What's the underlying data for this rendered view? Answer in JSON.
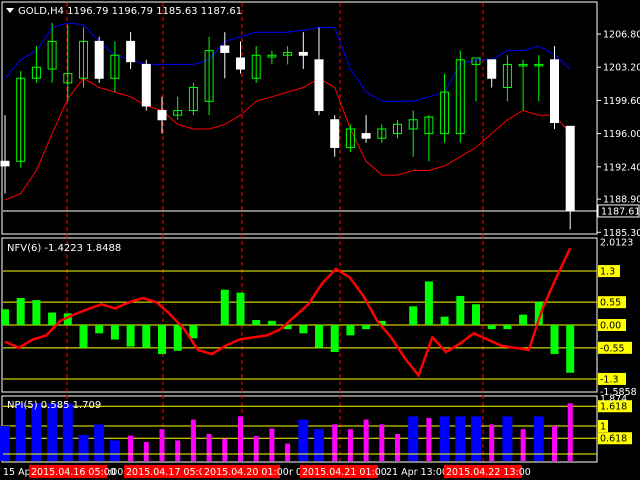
{
  "main_panel": {
    "title": "GOLD,H4  1196.79 1196.79 1185.63 1187.61",
    "price_ticks": [
      "1206.80",
      "1203.20",
      "1199.60",
      "1196.00",
      "1192.40",
      "1188.90",
      "1185.30"
    ],
    "current_price": "1187.61"
  },
  "nfv_panel": {
    "title": "NFV(6) -1.4223 1.8488",
    "top_label": "2.0123",
    "bottom_label": "-1.5858",
    "levels": [
      "1.3",
      "0.55",
      "0.00",
      "-0.55",
      "-1.3"
    ]
  },
  "npi_panel": {
    "title": "NPI(5) 0.585 1.709",
    "top_label": "1.874",
    "levels": [
      "1.618",
      "1",
      "0.618"
    ]
  },
  "time_axis": {
    "plain_labels": [
      "15 Ap",
      ":00",
      "r 05",
      "21 Apr 13:00"
    ],
    "highlighted_dates": [
      "2015.04.16 05:00",
      "2015.04.17 05:00",
      "2015.04.20 01:00",
      "2015.04.21 01:00",
      "2015.04.22 13:00"
    ]
  },
  "colors": {
    "background": "#000000",
    "bull_candle": "#00ff00",
    "bear_candle": "#ffffff",
    "upper_band": "#0000ff",
    "lower_band": "#ff0000",
    "level_line": "#ffff00",
    "marker_line": "#ff0000",
    "nfv_pos_hist": "#00ff00",
    "nfv_line": "#ff0000",
    "npi_blue": "#0000ff",
    "npi_magenta": "#ff00ff",
    "highlight_bg": "#ff0000",
    "level_label_bg": "#ffff00"
  },
  "chart_data": {
    "type": "candlestick",
    "candles": [
      {
        "o": 1193.0,
        "h": 1198.0,
        "c": 1192.5,
        "l": 1189.5
      },
      {
        "o": 1193.0,
        "h": 1202.8,
        "c": 1202.0,
        "l": 1192.3
      },
      {
        "o": 1202.0,
        "h": 1205.5,
        "c": 1203.2,
        "l": 1201.5
      },
      {
        "o": 1203.0,
        "h": 1208.0,
        "c": 1206.0,
        "l": 1201.5
      },
      {
        "o": 1201.5,
        "h": 1207.8,
        "c": 1202.5,
        "l": 1199.5
      },
      {
        "o": 1202.0,
        "h": 1207.5,
        "c": 1206.0,
        "l": 1201.0
      },
      {
        "o": 1206.0,
        "h": 1206.5,
        "c": 1202.0,
        "l": 1201.5
      },
      {
        "o": 1202.0,
        "h": 1206.0,
        "c": 1204.5,
        "l": 1200.5
      },
      {
        "o": 1206.0,
        "h": 1207.0,
        "c": 1203.8,
        "l": 1203.0
      },
      {
        "o": 1203.5,
        "h": 1204.0,
        "c": 1199.0,
        "l": 1198.5
      },
      {
        "o": 1198.5,
        "h": 1200.0,
        "c": 1197.5,
        "l": 1196.0
      },
      {
        "o": 1198.0,
        "h": 1200.0,
        "c": 1198.5,
        "l": 1197.5
      },
      {
        "o": 1198.5,
        "h": 1201.5,
        "c": 1201.0,
        "l": 1198.0
      },
      {
        "o": 1199.5,
        "h": 1206.5,
        "c": 1205.0,
        "l": 1198.0
      },
      {
        "o": 1205.5,
        "h": 1207.0,
        "c": 1204.8,
        "l": 1202.0
      },
      {
        "o": 1204.2,
        "h": 1206.0,
        "c": 1203.0,
        "l": 1202.5
      },
      {
        "o": 1202.0,
        "h": 1205.5,
        "c": 1204.5,
        "l": 1201.5
      },
      {
        "o": 1204.3,
        "h": 1205.0,
        "c": 1204.5,
        "l": 1203.5
      },
      {
        "o": 1204.5,
        "h": 1205.5,
        "c": 1204.8,
        "l": 1203.5
      },
      {
        "o": 1204.8,
        "h": 1207.0,
        "c": 1204.5,
        "l": 1203.0
      },
      {
        "o": 1204.0,
        "h": 1207.5,
        "c": 1198.5,
        "l": 1198.0
      },
      {
        "o": 1197.5,
        "h": 1198.0,
        "c": 1194.5,
        "l": 1193.5
      },
      {
        "o": 1194.5,
        "h": 1197.0,
        "c": 1196.5,
        "l": 1194.0
      },
      {
        "o": 1196.0,
        "h": 1198.0,
        "c": 1195.5,
        "l": 1195.0
      },
      {
        "o": 1195.5,
        "h": 1197.0,
        "c": 1196.5,
        "l": 1195.0
      },
      {
        "o": 1196.0,
        "h": 1197.5,
        "c": 1197.0,
        "l": 1195.5
      },
      {
        "o": 1196.5,
        "h": 1198.5,
        "c": 1197.5,
        "l": 1193.5
      },
      {
        "o": 1196.0,
        "h": 1198.0,
        "c": 1197.8,
        "l": 1193.0
      },
      {
        "o": 1196.0,
        "h": 1202.5,
        "c": 1200.5,
        "l": 1195.0
      },
      {
        "o": 1196.0,
        "h": 1205.0,
        "c": 1204.0,
        "l": 1195.0
      },
      {
        "o": 1203.5,
        "h": 1204.0,
        "c": 1204.2,
        "l": 1199.5
      },
      {
        "o": 1204.0,
        "h": 1204.0,
        "c": 1202.0,
        "l": 1201.0
      },
      {
        "o": 1201.0,
        "h": 1204.5,
        "c": 1203.5,
        "l": 1199.5
      },
      {
        "o": 1203.5,
        "h": 1204.0,
        "c": 1203.5,
        "l": 1198.5
      },
      {
        "o": 1203.5,
        "h": 1204.5,
        "c": 1203.5,
        "l": 1199.5
      },
      {
        "o": 1204.0,
        "h": 1205.5,
        "c": 1197.2,
        "l": 1196.5
      },
      {
        "o": 1196.79,
        "h": 1196.79,
        "c": 1187.61,
        "l": 1185.63
      }
    ],
    "upper_band": [
      1202,
      1204,
      1205,
      1207.5,
      1208,
      1207.8,
      1206,
      1204.5,
      1204,
      1203.5,
      1203.5,
      1203.5,
      1203.5,
      1204,
      1206,
      1206.5,
      1207,
      1207,
      1207,
      1207.2,
      1207.5,
      1207.5,
      1203,
      1200.5,
      1199.5,
      1199.5,
      1199.5,
      1200,
      1200.5,
      1203.5,
      1204,
      1204,
      1205,
      1205,
      1205.5,
      1204.5,
      1203
    ],
    "lower_band": [
      1188.8,
      1189.5,
      1192,
      1196,
      1199.8,
      1202,
      1201,
      1200.5,
      1200,
      1199,
      1198.5,
      1197,
      1196.5,
      1196.5,
      1197,
      1198,
      1199.5,
      1200,
      1200.5,
      1201,
      1202,
      1201,
      1196.5,
      1193,
      1191.5,
      1191.5,
      1192,
      1192,
      1192.5,
      1193.5,
      1194.5,
      1196,
      1197.5,
      1198.5,
      1198,
      1198,
      1196
    ],
    "nfv_hist": [
      0.38,
      0.65,
      0.6,
      0.3,
      0.28,
      -0.55,
      -0.2,
      -0.35,
      -0.52,
      -0.55,
      -0.7,
      -0.62,
      -0.32,
      0.0,
      0.85,
      0.78,
      0.12,
      0.1,
      -0.1,
      -0.2,
      -0.55,
      -0.65,
      -0.25,
      -0.1,
      0.1,
      0.0,
      0.45,
      1.05,
      0.2,
      0.7,
      0.5,
      -0.1,
      -0.1,
      0.25,
      0.55,
      -0.7,
      -1.15
    ],
    "nfv_line": [
      -0.4,
      -0.55,
      -0.35,
      -0.25,
      0.1,
      0.25,
      0.38,
      0.5,
      0.4,
      0.55,
      0.65,
      0.55,
      0.25,
      -0.1,
      -0.6,
      -0.7,
      -0.5,
      -0.35,
      -0.3,
      -0.25,
      -0.1,
      0.2,
      0.5,
      1.0,
      1.35,
      1.15,
      0.7,
      0.1,
      -0.3,
      -0.8,
      -1.22,
      -0.3,
      -0.65,
      -0.45,
      -0.2,
      -0.35,
      -0.5,
      -0.55,
      -0.6,
      0.4,
      1.15,
      1.85
    ],
    "npi": [
      {
        "v": 1.0,
        "c": "b"
      },
      {
        "v": 1.709,
        "c": "b"
      },
      {
        "v": 1.709,
        "c": "b"
      },
      {
        "v": 1.709,
        "c": "b"
      },
      {
        "v": 1.709,
        "c": "b"
      },
      {
        "v": 0.72,
        "c": "b"
      },
      {
        "v": 1.05,
        "c": "b"
      },
      {
        "v": 0.55,
        "c": "b"
      },
      {
        "v": 0.7,
        "c": "m"
      },
      {
        "v": 0.5,
        "c": "m"
      },
      {
        "v": 0.9,
        "c": "m"
      },
      {
        "v": 0.55,
        "c": "m"
      },
      {
        "v": 1.2,
        "c": "m"
      },
      {
        "v": 0.75,
        "c": "m"
      },
      {
        "v": 0.6,
        "c": "m"
      },
      {
        "v": 1.3,
        "c": "m"
      },
      {
        "v": 0.68,
        "c": "m"
      },
      {
        "v": 0.92,
        "c": "m"
      },
      {
        "v": 0.45,
        "c": "m"
      },
      {
        "v": 1.2,
        "c": "b"
      },
      {
        "v": 0.9,
        "c": "b"
      },
      {
        "v": 1.05,
        "c": "m"
      },
      {
        "v": 0.9,
        "c": "m"
      },
      {
        "v": 1.2,
        "c": "m"
      },
      {
        "v": 1.05,
        "c": "m"
      },
      {
        "v": 0.75,
        "c": "m"
      },
      {
        "v": 1.3,
        "c": "b"
      },
      {
        "v": 1.25,
        "c": "m"
      },
      {
        "v": 1.3,
        "c": "b"
      },
      {
        "v": 1.3,
        "c": "b"
      },
      {
        "v": 1.3,
        "c": "b"
      },
      {
        "v": 1.05,
        "c": "m"
      },
      {
        "v": 1.3,
        "c": "b"
      },
      {
        "v": 0.9,
        "c": "m"
      },
      {
        "v": 1.3,
        "c": "b"
      },
      {
        "v": 1.0,
        "c": "m"
      },
      {
        "v": 1.709,
        "c": "m"
      }
    ]
  }
}
